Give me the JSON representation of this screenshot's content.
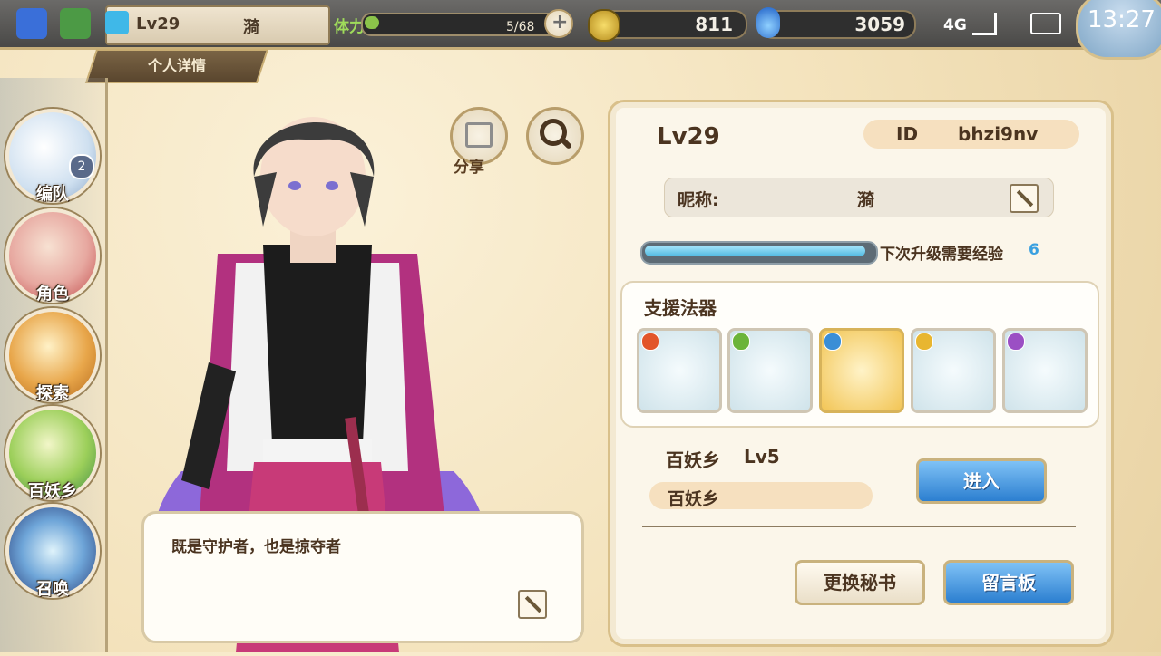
{
  "status_bar": {
    "level": "Lv29",
    "name": "漪",
    "stamina_label": "体力",
    "stamina_value": "5/68",
    "stamina_fraction": 0.074,
    "gold": "811",
    "gems": "3059",
    "network": "4G",
    "time": "13:27"
  },
  "page": {
    "title": "个人详情"
  },
  "side_menu": [
    {
      "label": "编队",
      "badge": "2"
    },
    {
      "label": "角色"
    },
    {
      "label": "探索"
    },
    {
      "label": "百妖乡"
    },
    {
      "label": "召唤"
    }
  ],
  "actions": {
    "share_label": "分享"
  },
  "speech": {
    "text": "既是守护者，也是掠夺者"
  },
  "profile": {
    "level": "Lv29",
    "id_label": "ID",
    "id_value": "bhzi9nv",
    "nickname_label": "昵称:",
    "nickname_value": "漪",
    "exp_label": "下次升级需要经验",
    "exp_value": "6",
    "exp_fraction": 0.98,
    "artifact_title": "支援法器",
    "artifacts": [
      {
        "icon": "chain-amulet-icon",
        "element_color": "#e2552a"
      },
      {
        "icon": "feather-hook-icon",
        "element_color": "#6bb43a"
      },
      {
        "icon": "wave-blade-icon",
        "element_color": "#3a8ed6"
      },
      {
        "icon": "pearl-mirror-icon",
        "element_color": "#e8b630"
      },
      {
        "icon": "bow-icon",
        "element_color": "#9b4fc4"
      }
    ],
    "village_name": "百妖乡",
    "village_level": "Lv5",
    "village_pill": "百妖乡",
    "enter_button": "进入",
    "change_secretary_button": "更换秘书",
    "message_board_button": "留言板"
  }
}
